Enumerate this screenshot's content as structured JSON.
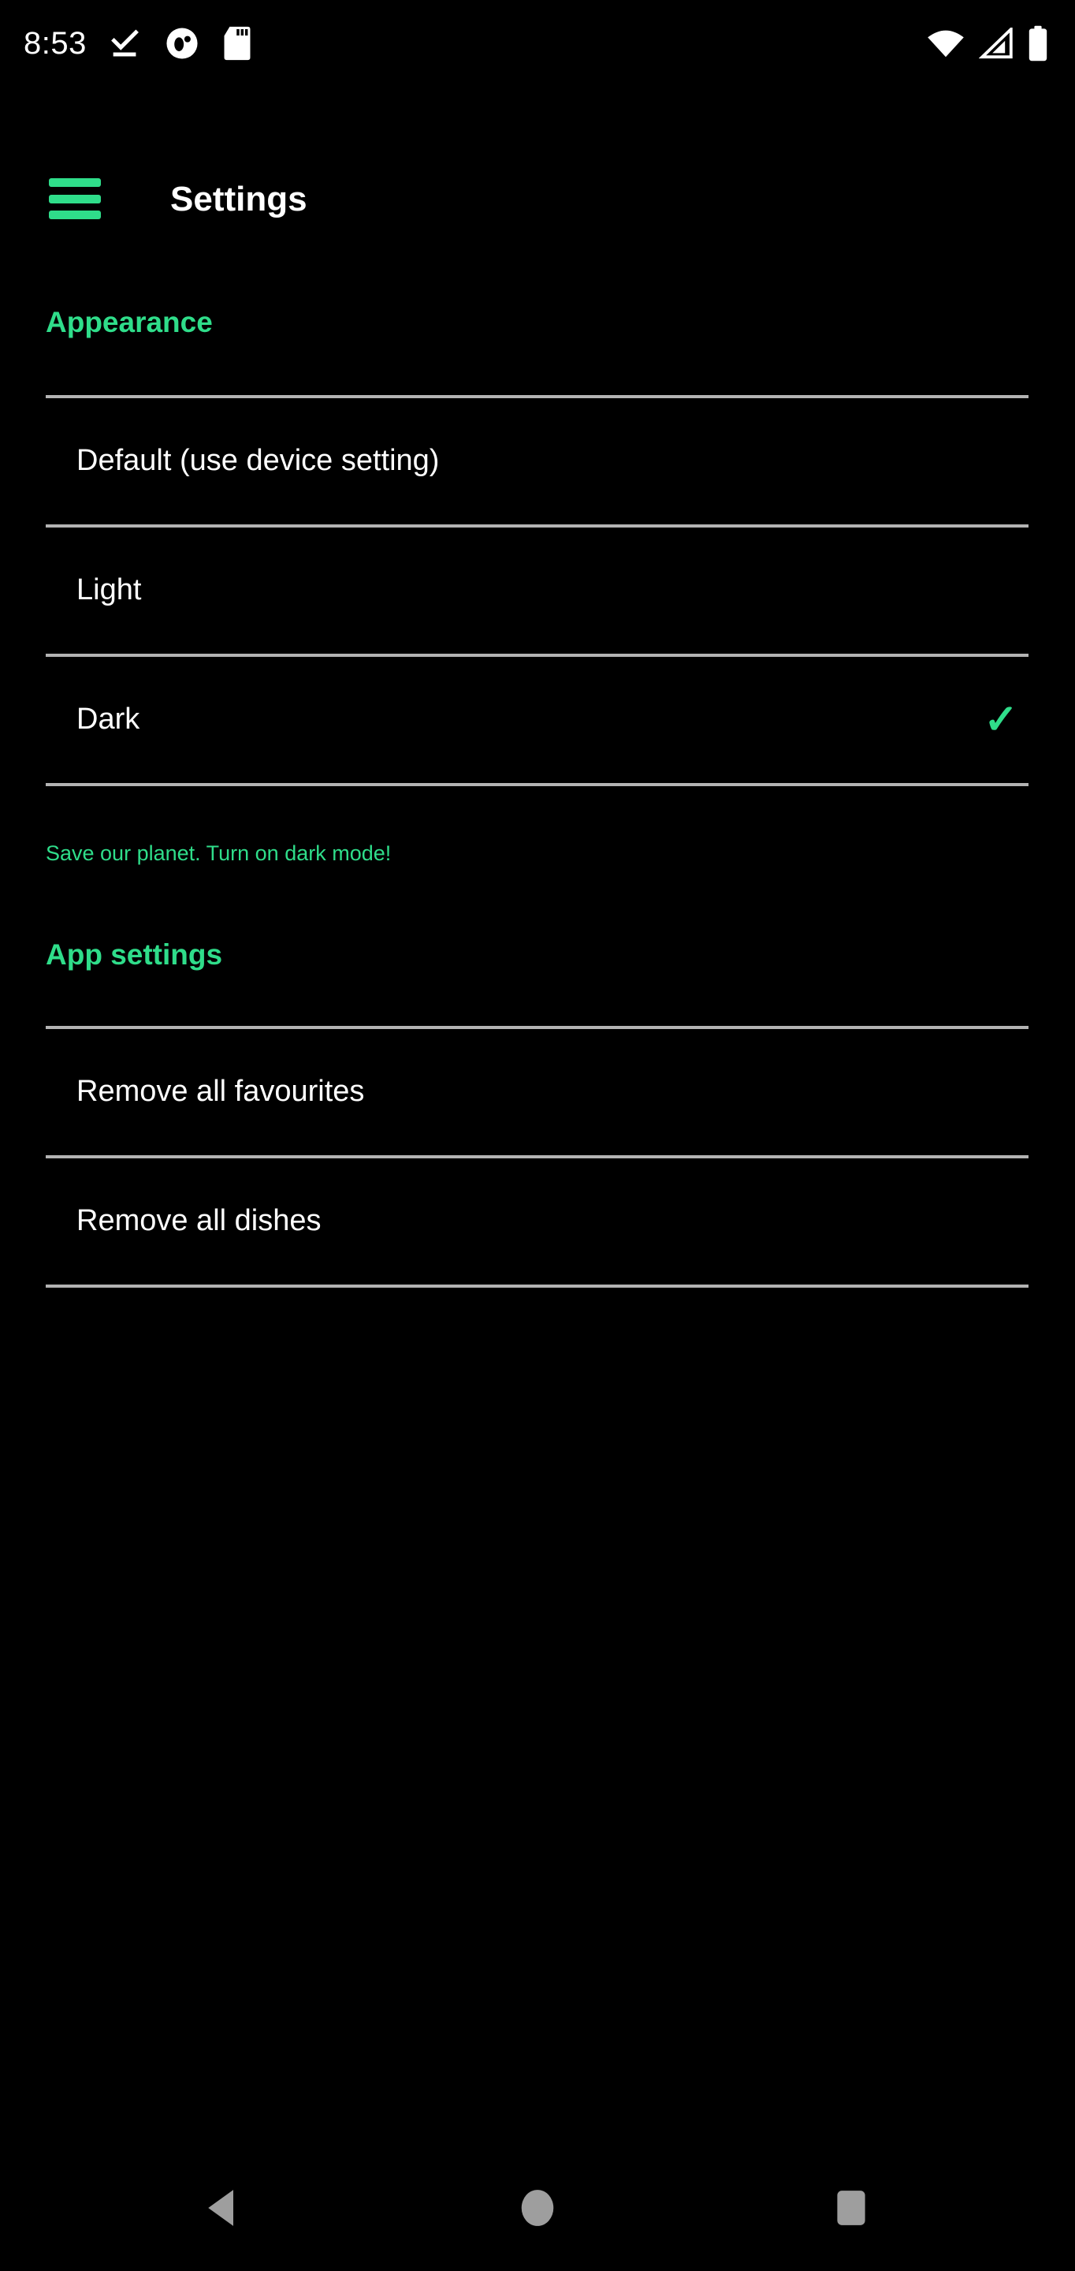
{
  "theme": {
    "accent_color": "#2fdd8a",
    "background_color": "#000000",
    "text_color": "#ffffff",
    "divider_color": "#b3b3b3",
    "nav_icon_color": "#9e9e9e"
  },
  "status_bar": {
    "time": "8:53",
    "left_icons": [
      "download-done-icon",
      "app-notification-icon",
      "sd-card-icon"
    ],
    "right_icons": [
      "wifi-icon",
      "cellular-signal-icon",
      "battery-icon"
    ]
  },
  "app_bar": {
    "menu_icon": "hamburger-menu-icon",
    "title": "Settings"
  },
  "sections": [
    {
      "header": "Appearance",
      "rows": [
        {
          "label": "Default (use device setting)",
          "selected": false
        },
        {
          "label": "Light",
          "selected": false
        },
        {
          "label": "Dark",
          "selected": true,
          "check_icon": "checkmark-icon"
        }
      ],
      "hint": "Save our planet. Turn on dark mode!"
    },
    {
      "header": "App settings",
      "rows": [
        {
          "label": "Remove all favourites",
          "selected": false
        },
        {
          "label": "Remove all dishes",
          "selected": false
        }
      ]
    }
  ],
  "nav_bar": {
    "back": "back-triangle-icon",
    "home": "home-circle-icon",
    "recents": "recents-square-icon"
  }
}
